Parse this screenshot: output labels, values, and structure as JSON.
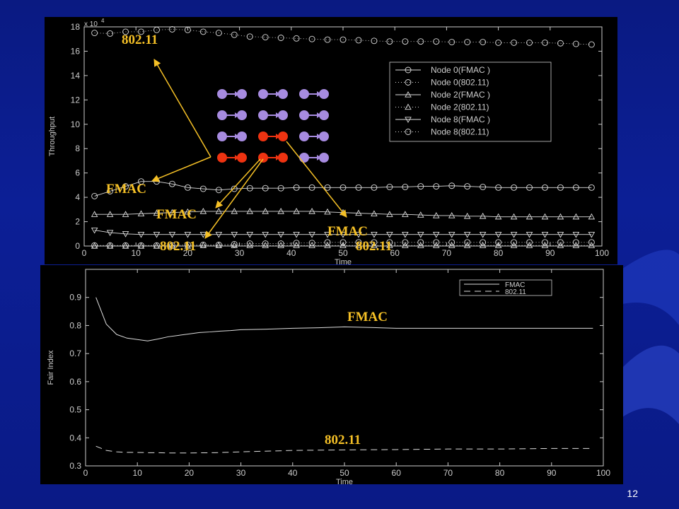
{
  "slide": {
    "page_number": "12",
    "background_color": "#0c1f96",
    "annotation_color": "#f5c026"
  },
  "annotations": {
    "top_80211": "802.11",
    "fmac_node0": "FMAC",
    "fmac_node2": "FMAC",
    "fmac_node8": "FMAC",
    "lbl_80211_node2": "802.11",
    "lbl_80211_node8": "802.11",
    "bottom_fmac": "FMAC",
    "bottom_80211": "802.11"
  },
  "topology": {
    "rows": 4,
    "cols": 3,
    "node_color": "#a78be0",
    "highlight_color": "#ee3311",
    "highlighted": [
      [
        2,
        1
      ],
      [
        3,
        0
      ],
      [
        3,
        1
      ]
    ]
  },
  "chart_data": [
    {
      "type": "line",
      "xlabel": "Time",
      "ylabel": "Throughput",
      "y_exponent_label": "x 10",
      "y_exponent_power": "4",
      "xlim": [
        0,
        100
      ],
      "ylim": [
        0,
        18
      ],
      "xticks": [
        0,
        10,
        20,
        30,
        40,
        50,
        60,
        70,
        80,
        90,
        100
      ],
      "yticks": [
        0,
        2,
        4,
        6,
        8,
        10,
        12,
        14,
        16,
        18
      ],
      "x": [
        2,
        5,
        8,
        11,
        14,
        17,
        20,
        23,
        26,
        29,
        32,
        35,
        38,
        41,
        44,
        47,
        50,
        53,
        56,
        59,
        62,
        65,
        68,
        71,
        74,
        77,
        80,
        83,
        86,
        89,
        92,
        95,
        98
      ],
      "legend_position": "right",
      "series": [
        {
          "name": "Node 0(FMAC  )",
          "marker": "circle",
          "line": "solid",
          "values": [
            4.1,
            4.5,
            4.9,
            5.3,
            5.3,
            5.1,
            4.8,
            4.7,
            4.6,
            4.7,
            4.75,
            4.75,
            4.75,
            4.8,
            4.8,
            4.8,
            4.8,
            4.8,
            4.8,
            4.85,
            4.85,
            4.9,
            4.9,
            4.95,
            4.9,
            4.85,
            4.8,
            4.8,
            4.8,
            4.8,
            4.8,
            4.8,
            4.8
          ]
        },
        {
          "name": "Node 0(802.11)",
          "marker": "circle",
          "line": "dotted",
          "values": [
            17.5,
            17.45,
            17.6,
            17.6,
            17.75,
            17.8,
            17.75,
            17.6,
            17.5,
            17.35,
            17.2,
            17.15,
            17.1,
            17.05,
            17.0,
            16.95,
            16.95,
            16.9,
            16.85,
            16.8,
            16.8,
            16.8,
            16.8,
            16.75,
            16.75,
            16.75,
            16.7,
            16.7,
            16.7,
            16.7,
            16.65,
            16.6,
            16.55
          ]
        },
        {
          "name": "Node 2(FMAC  )",
          "marker": "triangle-up",
          "line": "solid",
          "values": [
            2.6,
            2.6,
            2.6,
            2.65,
            2.7,
            2.75,
            2.8,
            2.85,
            2.85,
            2.85,
            2.85,
            2.85,
            2.85,
            2.85,
            2.85,
            2.8,
            2.75,
            2.7,
            2.65,
            2.6,
            2.6,
            2.55,
            2.5,
            2.5,
            2.45,
            2.45,
            2.4,
            2.4,
            2.4,
            2.4,
            2.4,
            2.4,
            2.4
          ]
        },
        {
          "name": "Node 2(802.11)",
          "marker": "triangle-up",
          "line": "dotted",
          "values": [
            0.0,
            0.0,
            0.0,
            0.0,
            0.0,
            0.0,
            0.0,
            0.05,
            0.05,
            0.05,
            0.05,
            0.05,
            0.05,
            0.05,
            0.05,
            0.05,
            0.05,
            0.05,
            0.05,
            0.05,
            0.05,
            0.05,
            0.05,
            0.05,
            0.05,
            0.05,
            0.05,
            0.05,
            0.05,
            0.05,
            0.05,
            0.05,
            0.05
          ]
        },
        {
          "name": "Node 8(FMAC  )",
          "marker": "triangle-down",
          "line": "solid",
          "values": [
            1.3,
            1.1,
            1.0,
            0.95,
            0.95,
            0.95,
            0.95,
            0.95,
            0.95,
            0.95,
            0.95,
            0.95,
            0.95,
            0.95,
            0.95,
            0.95,
            0.95,
            0.95,
            0.95,
            0.95,
            0.95,
            0.95,
            0.95,
            0.95,
            0.95,
            0.95,
            0.95,
            0.95,
            0.95,
            0.95,
            0.95,
            0.95,
            0.95
          ]
        },
        {
          "name": "Node 8(802.11)",
          "marker": "circle",
          "line": "dotted",
          "values": [
            0.05,
            0.05,
            0.05,
            0.05,
            0.05,
            0.05,
            0.1,
            0.1,
            0.1,
            0.15,
            0.2,
            0.2,
            0.2,
            0.25,
            0.25,
            0.3,
            0.3,
            0.3,
            0.3,
            0.3,
            0.3,
            0.3,
            0.3,
            0.3,
            0.3,
            0.3,
            0.3,
            0.3,
            0.3,
            0.3,
            0.3,
            0.3,
            0.3
          ]
        }
      ]
    },
    {
      "type": "line",
      "xlabel": "Time",
      "ylabel": "Fair Index",
      "xlim": [
        0,
        100
      ],
      "ylim": [
        0.3,
        1.0
      ],
      "xticks": [
        0,
        10,
        20,
        30,
        40,
        50,
        60,
        70,
        80,
        90,
        100
      ],
      "yticks": [
        0.3,
        0.4,
        0.5,
        0.6,
        0.7,
        0.8,
        0.9
      ],
      "legend_position": "top-right",
      "series": [
        {
          "name": "FMAC",
          "line": "solid",
          "x": [
            2,
            4,
            6,
            8,
            10,
            12,
            14,
            16,
            18,
            20,
            22,
            24,
            26,
            28,
            30,
            35,
            40,
            45,
            50,
            55,
            60,
            65,
            70,
            75,
            80,
            85,
            90,
            95,
            98
          ],
          "values": [
            0.9,
            0.805,
            0.768,
            0.755,
            0.75,
            0.745,
            0.752,
            0.76,
            0.765,
            0.77,
            0.775,
            0.777,
            0.78,
            0.782,
            0.785,
            0.787,
            0.79,
            0.792,
            0.795,
            0.793,
            0.79,
            0.79,
            0.79,
            0.79,
            0.79,
            0.79,
            0.79,
            0.79,
            0.79
          ]
        },
        {
          "name": "802.11",
          "line": "dashed",
          "x": [
            2,
            4,
            6,
            8,
            10,
            12,
            14,
            16,
            18,
            20,
            25,
            30,
            40,
            50,
            60,
            70,
            80,
            90,
            98
          ],
          "values": [
            0.37,
            0.355,
            0.35,
            0.348,
            0.348,
            0.347,
            0.347,
            0.346,
            0.346,
            0.346,
            0.347,
            0.35,
            0.355,
            0.357,
            0.358,
            0.36,
            0.36,
            0.362,
            0.362
          ]
        }
      ]
    }
  ]
}
